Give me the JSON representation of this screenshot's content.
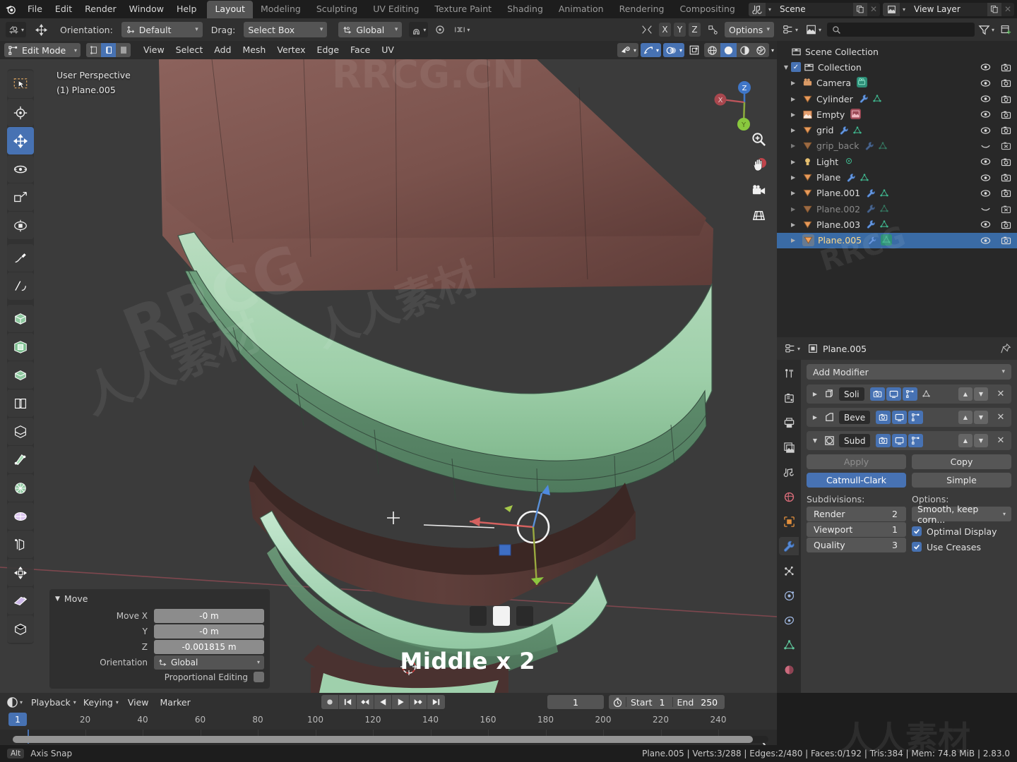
{
  "topbar": {
    "logo_icon": "blender-logo-icon",
    "menus": [
      "File",
      "Edit",
      "Render",
      "Window",
      "Help"
    ],
    "workspace_tabs": [
      "Layout",
      "Modeling",
      "Sculpting",
      "UV Editing",
      "Texture Paint",
      "Shading",
      "Animation",
      "Rendering",
      "Compositing"
    ],
    "active_workspace": "Layout",
    "scene_name": "Scene",
    "view_layer_name": "View Layer",
    "scene_icon": "scene-icon",
    "viewlayer_icon": "view-layer-icon",
    "new_icon": "duplicate-icon",
    "close_icon": "x-icon"
  },
  "tool_header": {
    "tool_icon": "active-tool-icon",
    "gizmo_icon": "move-gizmo-icon",
    "orientation_label": "Orientation:",
    "orientation_value": "Default",
    "drag_label": "Drag:",
    "drag_value": "Select Box",
    "transform_orientation": "Global",
    "snap_icon": "snap-magnet-icon",
    "proportional_icon": "proportional-edit-icon",
    "mirror_icon": "mirror-icon",
    "axis_x": "X",
    "axis_y": "Y",
    "axis_z": "Z",
    "options_label": "Options"
  },
  "viewport_header": {
    "mode": "Edit Mode",
    "mode_icon": "edit-mode-icon",
    "select_modes": [
      "vertex-select-icon",
      "edge-select-icon",
      "face-select-icon"
    ],
    "active_select_mode": 1,
    "menus": [
      "View",
      "Select",
      "Add",
      "Mesh",
      "Vertex",
      "Edge",
      "Face",
      "UV"
    ],
    "visibility_icon": "visibility-eye-icon",
    "xray_icon": "xray-icon",
    "overlays_icon": "overlays-icon",
    "gizmo_icon": "gizmo-icon",
    "shading_modes": [
      "wireframe-icon",
      "solid-icon",
      "material-preview-icon",
      "rendered-icon"
    ],
    "active_shading": 1
  },
  "viewport": {
    "perspective_label": "User Perspective",
    "object_label": "(1) Plane.005",
    "gizmo_axes": {
      "x": "X",
      "y": "Y",
      "z": "Z"
    },
    "nav_buttons": [
      "zoom-icon",
      "pan-hand-icon",
      "camera-view-icon",
      "toggle-perspective-icon"
    ],
    "key_display_label": "Middle x 2",
    "toolbar_tools": [
      "tweak-select-box-icon",
      "cursor-icon",
      "move-icon",
      "rotate-icon",
      "scale-icon",
      "transform-icon",
      "annotate-icon",
      "measure-icon",
      "add-cube-icon",
      "extrude-region-icon",
      "inset-faces-icon",
      "bevel-icon",
      "loop-cut-icon",
      "knife-icon",
      "poly-build-icon",
      "spin-icon",
      "smooth-icon",
      "edge-slide-icon",
      "shrink-fatten-icon",
      "shear-icon",
      "rip-region-icon"
    ],
    "active_tool_index": 2
  },
  "operator_panel": {
    "title": "Move",
    "rows": [
      {
        "label": "Move X",
        "value": "-0 m"
      },
      {
        "label": "Y",
        "value": "-0 m"
      },
      {
        "label": "Z",
        "value": "-0.001815 m"
      }
    ],
    "orientation_label": "Orientation",
    "orientation_value": "Global",
    "proportional_label": "Proportional Editing",
    "proportional_checked": false
  },
  "outliner": {
    "display_mode_icon": "outliner-display-icon",
    "filter_id_icon": "filter-id-icon",
    "search_icon": "search-icon",
    "search_placeholder": "",
    "filter_icon": "funnel-filter-icon",
    "new_collection_icon": "new-collection-icon",
    "root": "Scene Collection",
    "collection": "Collection",
    "items": [
      {
        "name": "Camera",
        "icon": "camera-data-icon",
        "type_icons": [
          "camera-object-icon"
        ],
        "dim": false,
        "hidden": false
      },
      {
        "name": "Cylinder",
        "icon": "mesh-object-icon",
        "type_icons": [
          "modifier-wrench-icon",
          "mesh-data-icon"
        ],
        "dim": false,
        "hidden": false
      },
      {
        "name": "Empty",
        "icon": "empty-image-icon",
        "type_icons": [
          "image-data-icon"
        ],
        "dim": false,
        "hidden": false
      },
      {
        "name": "grid",
        "icon": "mesh-object-icon",
        "type_icons": [
          "modifier-wrench-icon",
          "mesh-data-icon"
        ],
        "dim": false,
        "hidden": false
      },
      {
        "name": "grip_back",
        "icon": "mesh-object-icon",
        "type_icons": [
          "modifier-wrench-icon",
          "mesh-data-icon"
        ],
        "dim": true,
        "hidden": true
      },
      {
        "name": "Light",
        "icon": "light-object-icon",
        "type_icons": [
          "light-data-icon"
        ],
        "dim": false,
        "hidden": false
      },
      {
        "name": "Plane",
        "icon": "mesh-object-icon",
        "type_icons": [
          "modifier-wrench-icon",
          "mesh-data-icon"
        ],
        "dim": false,
        "hidden": false
      },
      {
        "name": "Plane.001",
        "icon": "mesh-object-icon",
        "type_icons": [
          "modifier-wrench-icon",
          "mesh-data-icon"
        ],
        "dim": false,
        "hidden": false
      },
      {
        "name": "Plane.002",
        "icon": "mesh-object-icon",
        "type_icons": [
          "modifier-wrench-icon",
          "mesh-data-icon"
        ],
        "dim": true,
        "hidden": true
      },
      {
        "name": "Plane.003",
        "icon": "mesh-object-icon",
        "type_icons": [
          "modifier-wrench-icon",
          "mesh-data-icon"
        ],
        "dim": false,
        "hidden": false
      },
      {
        "name": "Plane.005",
        "icon": "mesh-object-icon",
        "type_icons": [
          "modifier-wrench-icon",
          "mesh-data-icon"
        ],
        "dim": false,
        "hidden": false,
        "selected": true
      }
    ]
  },
  "properties": {
    "editor_icon": "properties-editor-icon",
    "breadcrumb_icon": "object-icon",
    "breadcrumb": "Plane.005",
    "pin_icon": "pin-icon",
    "tabs": [
      "tool-icon",
      "render-icon",
      "output-icon",
      "view-layer-icon",
      "scene-icon",
      "world-icon",
      "object-icon",
      "modifier-wrench-icon",
      "particles-icon",
      "physics-icon",
      "constraints-icon",
      "data-mesh-icon",
      "material-icon"
    ],
    "active_tab": 7,
    "add_modifier": "Add Modifier",
    "modifiers": [
      {
        "name": "Soli",
        "icon": "solidify-icon",
        "expanded": false,
        "toggles": [
          "render",
          "realtime",
          "edit-mode",
          "on-cage"
        ],
        "toggles_on": [
          true,
          true,
          true,
          false
        ]
      },
      {
        "name": "Beve",
        "icon": "bevel-icon",
        "expanded": false,
        "toggles": [
          "render",
          "realtime",
          "edit-mode"
        ],
        "toggles_on": [
          true,
          true,
          true
        ]
      },
      {
        "name": "Subd",
        "icon": "subsurf-icon",
        "expanded": true,
        "toggles": [
          "render",
          "realtime",
          "edit-mode"
        ],
        "toggles_on": [
          true,
          true,
          true
        ]
      }
    ],
    "apply_label": "Apply",
    "copy_label": "Copy",
    "algorithm_options": [
      "Catmull-Clark",
      "Simple"
    ],
    "algorithm_active": "Catmull-Clark",
    "subdivisions_label": "Subdivisions:",
    "subdivisions": [
      {
        "label": "Render",
        "value": "2"
      },
      {
        "label": "Viewport",
        "value": "1"
      },
      {
        "label": "Quality",
        "value": "3"
      }
    ],
    "options_label": "Options:",
    "uv_smooth": "Smooth, keep corn...",
    "checkboxes": [
      {
        "label": "Optimal Display",
        "checked": true
      },
      {
        "label": "Use Creases",
        "checked": true
      }
    ]
  },
  "timeline": {
    "editor_icon": "timeline-editor-icon",
    "menus": [
      "Playback",
      "Keying",
      "View",
      "Marker"
    ],
    "playback_buttons": [
      "record-icon",
      "jump-start-icon",
      "prev-keyframe-icon",
      "play-reverse-icon",
      "play-icon",
      "next-keyframe-icon",
      "jump-end-icon"
    ],
    "current_frame": "1",
    "use_preview_icon": "stopwatch-icon",
    "start_label": "Start",
    "start_value": "1",
    "end_label": "End",
    "end_value": "250",
    "ticks": [
      "20",
      "40",
      "60",
      "80",
      "100",
      "120",
      "140",
      "160",
      "180",
      "200",
      "220",
      "240"
    ],
    "playhead_frame": "1"
  },
  "statusbar": {
    "modifier_key": "Alt",
    "hint": "Axis Snap",
    "stats": "Plane.005 | Verts:3/288 | Edges:2/480 | Faces:0/192 | Tris:384 | Mem: 74.8 MiB | 2.83.0"
  },
  "watermarks": [
    "RRCG.CN",
    "RRCG",
    "人人素材",
    "人人素材"
  ],
  "colors": {
    "accent_blue": "#4772b3",
    "selection_orange": "#ffd98a",
    "mesh_green": "#a8d5b0",
    "mesh_brown": "#6b4440",
    "panel_bg": "#303030",
    "viewport_bg": "#3b3b3b"
  }
}
